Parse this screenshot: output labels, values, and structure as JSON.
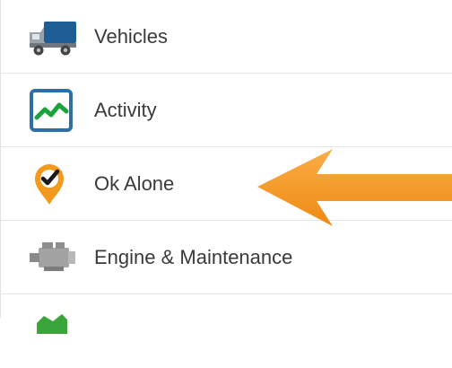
{
  "menu": {
    "items": [
      {
        "label": "Vehicles",
        "icon": "truck-icon"
      },
      {
        "label": "Activity",
        "icon": "activity-chart-icon"
      },
      {
        "label": "Ok Alone",
        "icon": "location-check-icon"
      },
      {
        "label": "Engine & Maintenance",
        "icon": "engine-icon"
      },
      {
        "label": "",
        "icon": "green-icon"
      }
    ]
  },
  "annotation": {
    "arrow_color": "#f7941d",
    "icon": "arrow-left-icon"
  },
  "colors": {
    "truck_blue": "#1f5e95",
    "activity_border": "#2e6fa8",
    "activity_line": "#1aa33a",
    "pin_orange": "#f39a1e",
    "engine_gray": "#9d9d9d",
    "text": "#3a3a3a"
  }
}
